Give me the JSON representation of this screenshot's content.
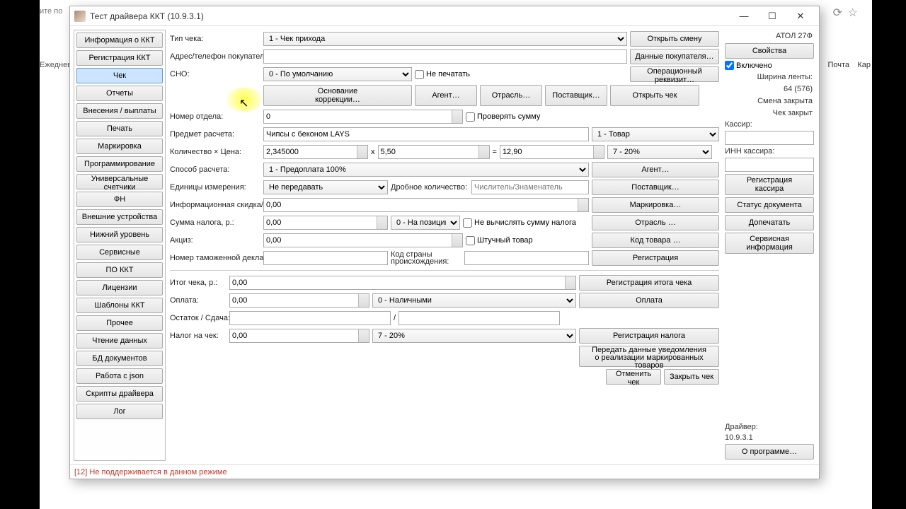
{
  "window": {
    "title": "Тест драйвера ККТ (10.9.3.1)"
  },
  "sidebar": {
    "items": [
      "Информация о ККТ",
      "Регистрация ККТ",
      "Чек",
      "Отчеты",
      "Внесения / выплаты",
      "Печать",
      "Маркировка",
      "Программирование",
      "Универсальные счетчики",
      "ФН",
      "Внешние устройства",
      "Нижний уровень",
      "Сервисные",
      "ПО ККТ",
      "Лицензии",
      "Шаблоны ККТ",
      "Прочее",
      "Чтение данных",
      "БД документов",
      "Работа с json",
      "Скрипты драйвера",
      "Лог"
    ],
    "active_index": 2
  },
  "main": {
    "type_label": "Тип чека:",
    "type_value": "1 - Чек прихода",
    "open_shift": "Открыть смену",
    "addr_label": "Адрес/телефон покупателя:",
    "buyer_data": "Данные покупателя…",
    "sno_label": "СНО:",
    "sno_value": "0 - По умолчанию",
    "no_print": "Не печатать",
    "op_req": "Операционный реквизит…",
    "basis": "Основание\nкоррекции…",
    "agent": "Агент…",
    "industry": "Отрасль…",
    "supplier": "Поставщик…",
    "open_check": "Открыть чек",
    "dept_label": "Номер отдела:",
    "dept_value": "0",
    "check_sum": "Проверять сумму",
    "item_label": "Предмет расчета:",
    "item_value": "Чипсы с беконом LAYS",
    "item_type": "1 - Товар",
    "qty_label": "Количество × Цена:",
    "qty": "2,345000",
    "x": "x",
    "price": "5,50",
    "eq": "=",
    "total": "12,90",
    "vat": "7 - 20%",
    "method_label": "Способ расчета:",
    "method_value": "1 - Предоплата 100%",
    "agent2": "Агент…",
    "unit_label": "Единицы измерения:",
    "unit_value": "Не передавать",
    "frac_label": "Дробное количество:",
    "frac_placeholder": "Числитель/Знаменатель",
    "supplier2": "Поставщик…",
    "disc_label": "Информационная скидка/надбавка, р.:",
    "disc_value": "0,00",
    "marking": "Маркировка…",
    "tax_sum_label": "Сумма налога, р.:",
    "tax_sum": "0,00",
    "tax_pos": "0 - На позицию",
    "no_calc_tax": "Не вычислять сумму налога",
    "industry2": "Отрасль …",
    "excise_label": "Акциз:",
    "excise": "0,00",
    "piece": "Штучный товар",
    "item_code": "Код товара …",
    "customs_label": "Номер таможенной декларации:",
    "country_label": "Код страны происхождения:",
    "registration": "Регистрация",
    "total_label": "Итог чека, р.:",
    "total_value": "0,00",
    "reg_total": "Регистрация итога чека",
    "pay_label": "Оплата:",
    "pay_value": "0,00",
    "pay_type": "0 - Наличными",
    "payment": "Оплата",
    "rest_label": "Остаток / Сдача:",
    "slash": "/",
    "taxcheck_label": "Налог на чек:",
    "taxcheck": "0,00",
    "taxcheck_vat": "7 - 20%",
    "reg_tax": "Регистрация налога",
    "transmit": "Передать данные уведомления\nо реализации маркированных товаров",
    "cancel_check": "Отменить чек",
    "close_check": "Закрыть чек"
  },
  "rightbar": {
    "device": "АТОЛ 27Ф",
    "props": "Свойства",
    "enabled": "Включено",
    "tape": "Ширина ленты:",
    "tape_val": "64 (576)",
    "shift": "Смена закрыта",
    "check": "Чек закрыт",
    "cashier": "Кассир:",
    "inn": "ИНН кассира:",
    "reg_cashier": "Регистрация\nкассира",
    "doc_status": "Статус документа",
    "reprint": "Допечатать",
    "service": "Сервисная\nинформация",
    "driver": "Драйвер:",
    "driver_ver": "10.9.3.1",
    "about": "О программе…"
  },
  "status": "[12] Не поддерживается в данном режиме"
}
